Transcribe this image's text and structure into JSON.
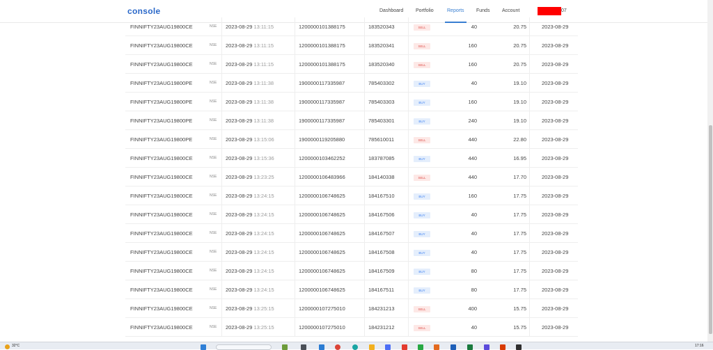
{
  "header": {
    "logo": "console",
    "nav": [
      "Dashboard",
      "Portfolio",
      "Reports",
      "Funds",
      "Account"
    ],
    "active_nav": "Reports",
    "user_id_suffix": "07"
  },
  "trades": [
    {
      "symbol": "FINNIFTY23AUG19800CE",
      "exchange": "NSE",
      "date": "2023-08-29",
      "time": "13:11:15",
      "trade_id": "1200000101388175",
      "order_id": "183520343",
      "type": "SELL",
      "qty": "40",
      "price": "20.75",
      "settlement_date": "2023-08-29"
    },
    {
      "symbol": "FINNIFTY23AUG19800CE",
      "exchange": "NSE",
      "date": "2023-08-29",
      "time": "13:11:15",
      "trade_id": "1200000101388175",
      "order_id": "183520341",
      "type": "SELL",
      "qty": "160",
      "price": "20.75",
      "settlement_date": "2023-08-29"
    },
    {
      "symbol": "FINNIFTY23AUG19800CE",
      "exchange": "NSE",
      "date": "2023-08-29",
      "time": "13:11:15",
      "trade_id": "1200000101388175",
      "order_id": "183520340",
      "type": "SELL",
      "qty": "160",
      "price": "20.75",
      "settlement_date": "2023-08-29"
    },
    {
      "symbol": "FINNIFTY23AUG19800PE",
      "exchange": "NSE",
      "date": "2023-08-29",
      "time": "13:11:38",
      "trade_id": "1900000117335987",
      "order_id": "785403302",
      "type": "BUY",
      "qty": "40",
      "price": "19.10",
      "settlement_date": "2023-08-29"
    },
    {
      "symbol": "FINNIFTY23AUG19800PE",
      "exchange": "NSE",
      "date": "2023-08-29",
      "time": "13:11:38",
      "trade_id": "1900000117335987",
      "order_id": "785403303",
      "type": "BUY",
      "qty": "160",
      "price": "19.10",
      "settlement_date": "2023-08-29"
    },
    {
      "symbol": "FINNIFTY23AUG19800PE",
      "exchange": "NSE",
      "date": "2023-08-29",
      "time": "13:11:38",
      "trade_id": "1900000117335987",
      "order_id": "785403301",
      "type": "BUY",
      "qty": "240",
      "price": "19.10",
      "settlement_date": "2023-08-29"
    },
    {
      "symbol": "FINNIFTY23AUG19800PE",
      "exchange": "NSE",
      "date": "2023-08-29",
      "time": "13:15:06",
      "trade_id": "1900000119205880",
      "order_id": "785610011",
      "type": "SELL",
      "qty": "440",
      "price": "22.80",
      "settlement_date": "2023-08-29"
    },
    {
      "symbol": "FINNIFTY23AUG19800CE",
      "exchange": "NSE",
      "date": "2023-08-29",
      "time": "13:15:36",
      "trade_id": "1200000103462252",
      "order_id": "183787085",
      "type": "BUY",
      "qty": "440",
      "price": "16.95",
      "settlement_date": "2023-08-29"
    },
    {
      "symbol": "FINNIFTY23AUG19800CE",
      "exchange": "NSE",
      "date": "2023-08-29",
      "time": "13:23:25",
      "trade_id": "1200000106483966",
      "order_id": "184140338",
      "type": "SELL",
      "qty": "440",
      "price": "17.70",
      "settlement_date": "2023-08-29"
    },
    {
      "symbol": "FINNIFTY23AUG19800CE",
      "exchange": "NSE",
      "date": "2023-08-29",
      "time": "13:24:15",
      "trade_id": "1200000106748625",
      "order_id": "184167510",
      "type": "BUY",
      "qty": "160",
      "price": "17.75",
      "settlement_date": "2023-08-29"
    },
    {
      "symbol": "FINNIFTY23AUG19800CE",
      "exchange": "NSE",
      "date": "2023-08-29",
      "time": "13:24:15",
      "trade_id": "1200000106748625",
      "order_id": "184167506",
      "type": "BUY",
      "qty": "40",
      "price": "17.75",
      "settlement_date": "2023-08-29"
    },
    {
      "symbol": "FINNIFTY23AUG19800CE",
      "exchange": "NSE",
      "date": "2023-08-29",
      "time": "13:24:15",
      "trade_id": "1200000106748625",
      "order_id": "184167507",
      "type": "BUY",
      "qty": "40",
      "price": "17.75",
      "settlement_date": "2023-08-29"
    },
    {
      "symbol": "FINNIFTY23AUG19800CE",
      "exchange": "NSE",
      "date": "2023-08-29",
      "time": "13:24:15",
      "trade_id": "1200000106748625",
      "order_id": "184167508",
      "type": "BUY",
      "qty": "40",
      "price": "17.75",
      "settlement_date": "2023-08-29"
    },
    {
      "symbol": "FINNIFTY23AUG19800CE",
      "exchange": "NSE",
      "date": "2023-08-29",
      "time": "13:24:15",
      "trade_id": "1200000106748625",
      "order_id": "184167509",
      "type": "BUY",
      "qty": "80",
      "price": "17.75",
      "settlement_date": "2023-08-29"
    },
    {
      "symbol": "FINNIFTY23AUG19800CE",
      "exchange": "NSE",
      "date": "2023-08-29",
      "time": "13:24:15",
      "trade_id": "1200000106748625",
      "order_id": "184167511",
      "type": "BUY",
      "qty": "80",
      "price": "17.75",
      "settlement_date": "2023-08-29"
    },
    {
      "symbol": "FINNIFTY23AUG19800CE",
      "exchange": "NSE",
      "date": "2023-08-29",
      "time": "13:25:15",
      "trade_id": "1200000107275010",
      "order_id": "184231213",
      "type": "SELL",
      "qty": "400",
      "price": "15.75",
      "settlement_date": "2023-08-29"
    },
    {
      "symbol": "FINNIFTY23AUG19800CE",
      "exchange": "NSE",
      "date": "2023-08-29",
      "time": "13:25:15",
      "trade_id": "1200000107275010",
      "order_id": "184231212",
      "type": "SELL",
      "qty": "40",
      "price": "15.75",
      "settlement_date": "2023-08-29"
    }
  ],
  "taskbar": {
    "temperature": "32°C",
    "clock": "17:16"
  },
  "colors": {
    "accent": "#387ed1",
    "sell_text": "#df514c",
    "buy_text": "#4184f3",
    "redaction": "#ff0000"
  }
}
